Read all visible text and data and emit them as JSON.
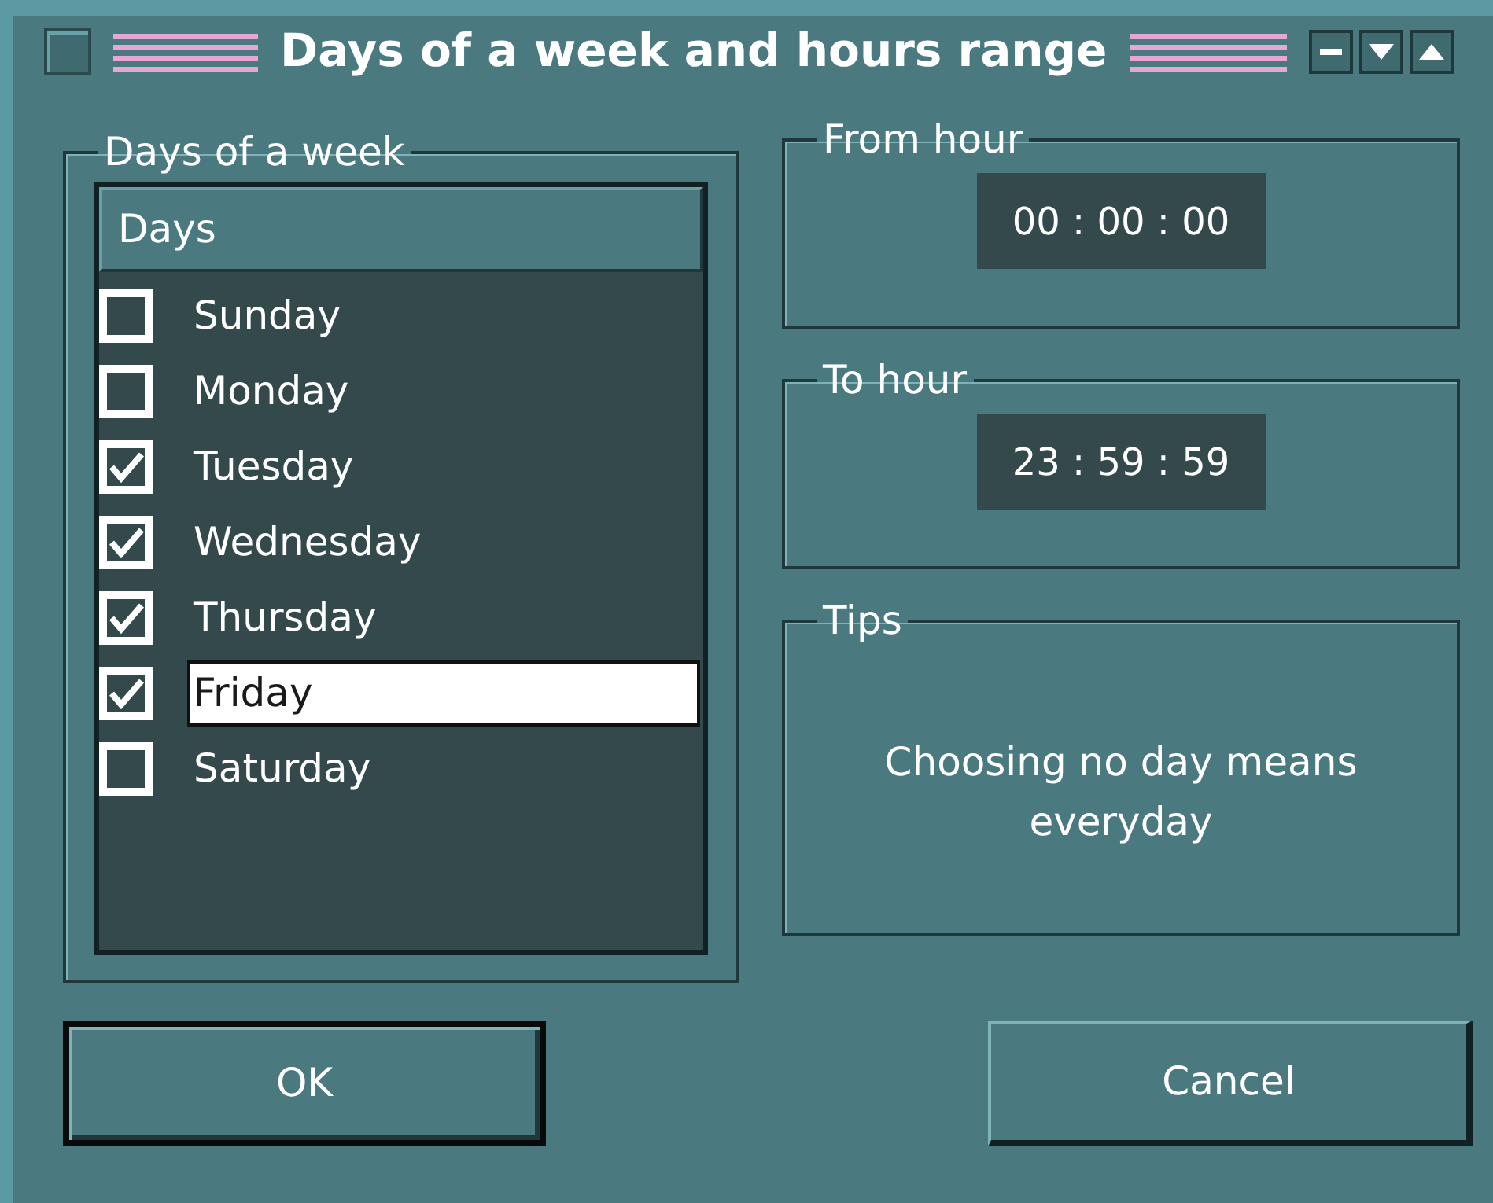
{
  "window": {
    "title": "Days of a week and hours range"
  },
  "days_group": {
    "title": "Days of a week",
    "column": "Days",
    "items": [
      {
        "label": "Sunday",
        "checked": false,
        "selected": false
      },
      {
        "label": "Monday",
        "checked": false,
        "selected": false
      },
      {
        "label": "Tuesday",
        "checked": true,
        "selected": false
      },
      {
        "label": "Wednesday",
        "checked": true,
        "selected": false
      },
      {
        "label": "Thursday",
        "checked": true,
        "selected": false
      },
      {
        "label": "Friday",
        "checked": true,
        "selected": true
      },
      {
        "label": "Saturday",
        "checked": false,
        "selected": false
      }
    ]
  },
  "from_hour": {
    "title": "From hour",
    "value": "00 : 00 : 00"
  },
  "to_hour": {
    "title": "To hour",
    "value": "23 : 59 : 59"
  },
  "tips": {
    "title": "Tips",
    "text": "Choosing no day means everyday"
  },
  "buttons": [
    {
      "label": "OK",
      "default": true
    },
    {
      "label": "Cancel",
      "default": false
    }
  ]
}
